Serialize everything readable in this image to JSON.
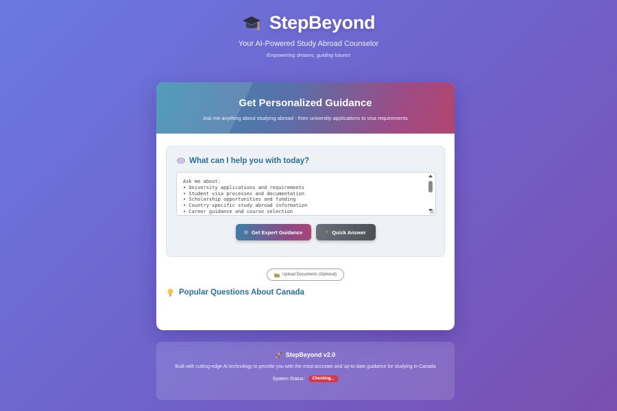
{
  "header": {
    "brand_icon": "graduation-cap-icon",
    "title": "StepBeyond",
    "tagline": "Your AI-Powered Study Abroad Counselor",
    "subtagline": "Empowering dreams, guiding futures"
  },
  "card": {
    "title": "Get Personalized Guidance",
    "subtitle": "Ask me anything about studying abroad - from university applications to visa requirements",
    "question_icon": "speech-bubble-icon",
    "question_label": "What can I help you with today?",
    "textarea_placeholder": "Ask me about:\n• University applications and requirements\n• Student visa processes and documentation\n• Scholarship opportunities and funding\n• Country-specific study abroad information\n• Career guidance and course selection",
    "expert_button": "Get Expert Guidance",
    "expert_button_icon": "target-icon",
    "quick_button": "Quick Answer",
    "quick_button_icon": "lightning-icon",
    "upload_button": "Upload Documents (Optional)",
    "upload_icon": "folder-icon",
    "popular_icon": "lightbulb-icon",
    "popular_title": "Popular Questions About Canada"
  },
  "footer": {
    "icon": "rocket-icon",
    "title": "StepBeyond v2.0",
    "description": "Built with cutting-edge AI technology to provide you with the most accurate and up-to-date guidance for studying in Canada",
    "status_label": "System Status:",
    "status_value": "Checking..."
  },
  "colors": {
    "accent_teal": "#2b6f96",
    "accent_magenta": "#a9467b",
    "status_red": "#d23a4a"
  }
}
